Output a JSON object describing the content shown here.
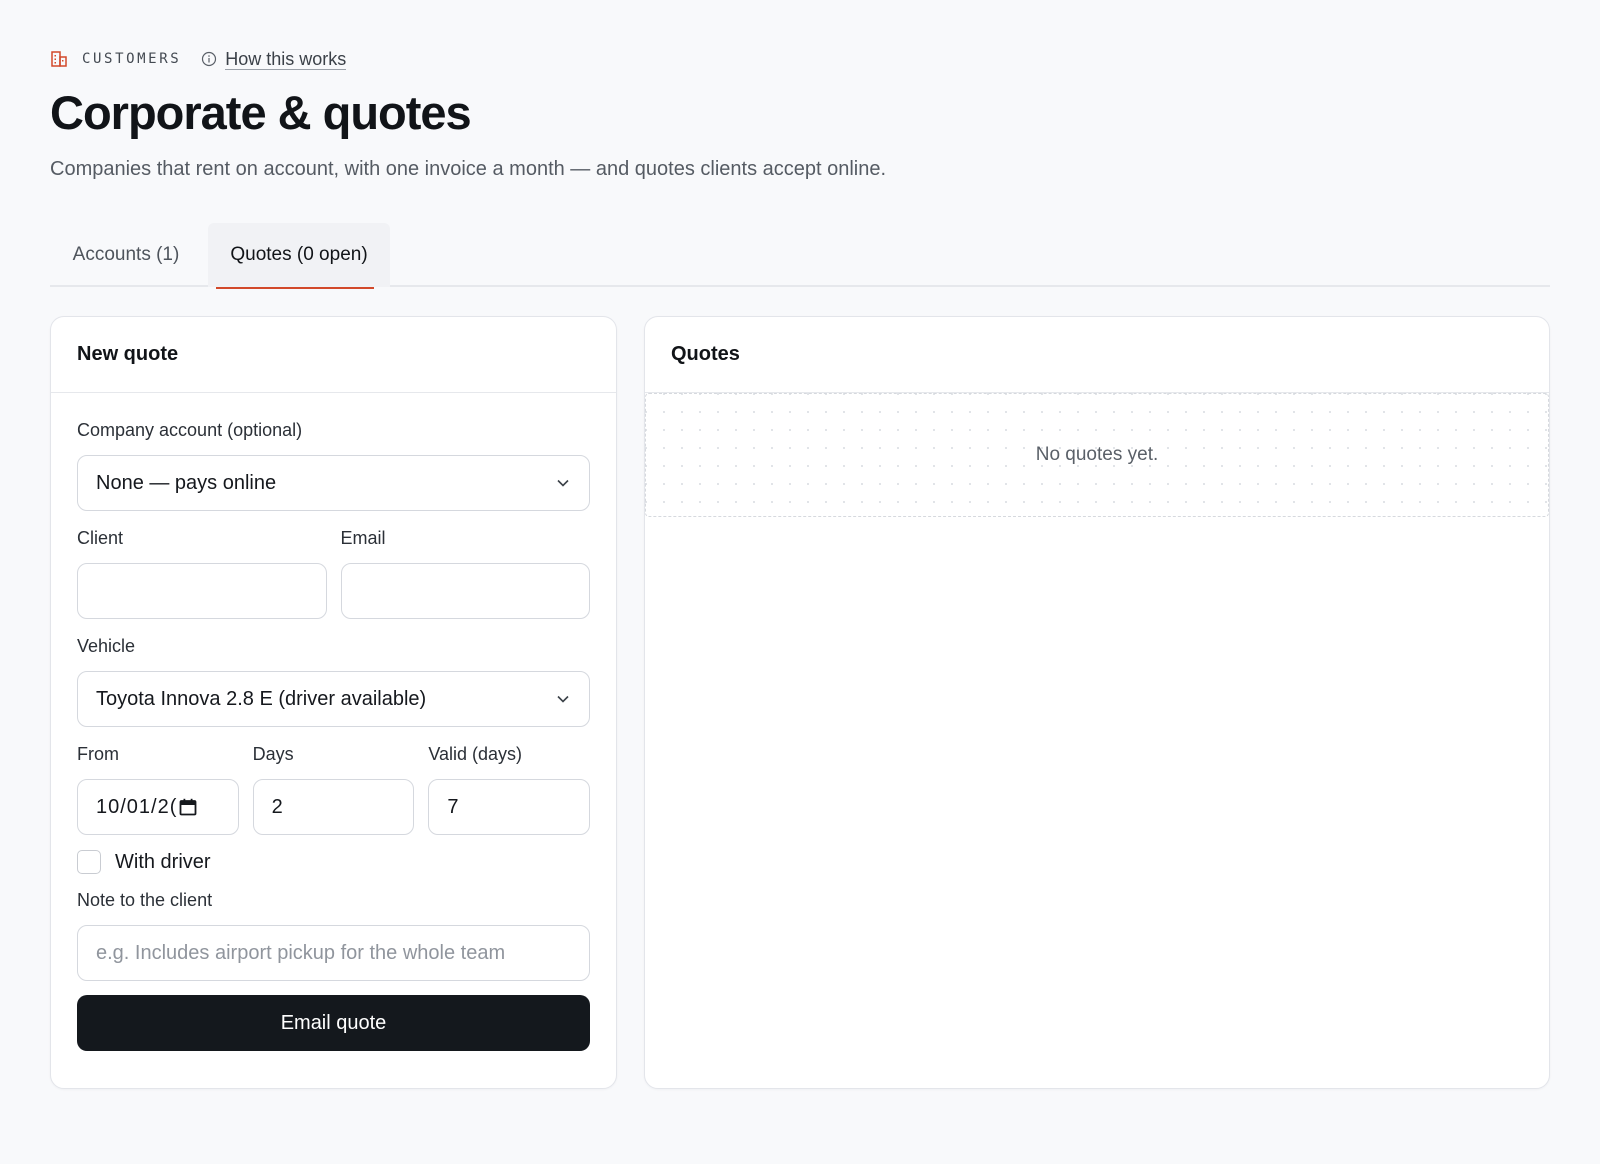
{
  "header": {
    "eyebrow": "CUSTOMERS",
    "help_link": "How this works",
    "title": "Corporate & quotes",
    "subtitle": "Companies that rent on account, with one invoice a month — and quotes clients accept online."
  },
  "tabs": [
    {
      "label": "Accounts (1)",
      "active": false
    },
    {
      "label": "Quotes (0 open)",
      "active": true
    }
  ],
  "new_quote": {
    "title": "New quote",
    "company_label": "Company account (optional)",
    "company_value": "None — pays online",
    "client_label": "Client",
    "client_value": "",
    "email_label": "Email",
    "email_value": "",
    "vehicle_label": "Vehicle",
    "vehicle_value": "Toyota Innova 2.8 E (driver available)",
    "from_label": "From",
    "from_value": "10/01/2(",
    "days_label": "Days",
    "days_value": "2",
    "valid_label": "Valid (days)",
    "valid_value": "7",
    "driver_label": "With driver",
    "driver_checked": false,
    "note_label": "Note to the client",
    "note_placeholder": "e.g. Includes airport pickup for the whole team",
    "submit_label": "Email quote"
  },
  "quotes_panel": {
    "title": "Quotes",
    "empty_text": "No quotes yet."
  },
  "colors": {
    "accent": "#d2492a",
    "button": "#14181d",
    "background": "#f8f9fb"
  },
  "icons": {
    "eyebrow": "building-icon",
    "help": "info-icon",
    "select": "chevron-down-icon",
    "date": "calendar-icon"
  }
}
